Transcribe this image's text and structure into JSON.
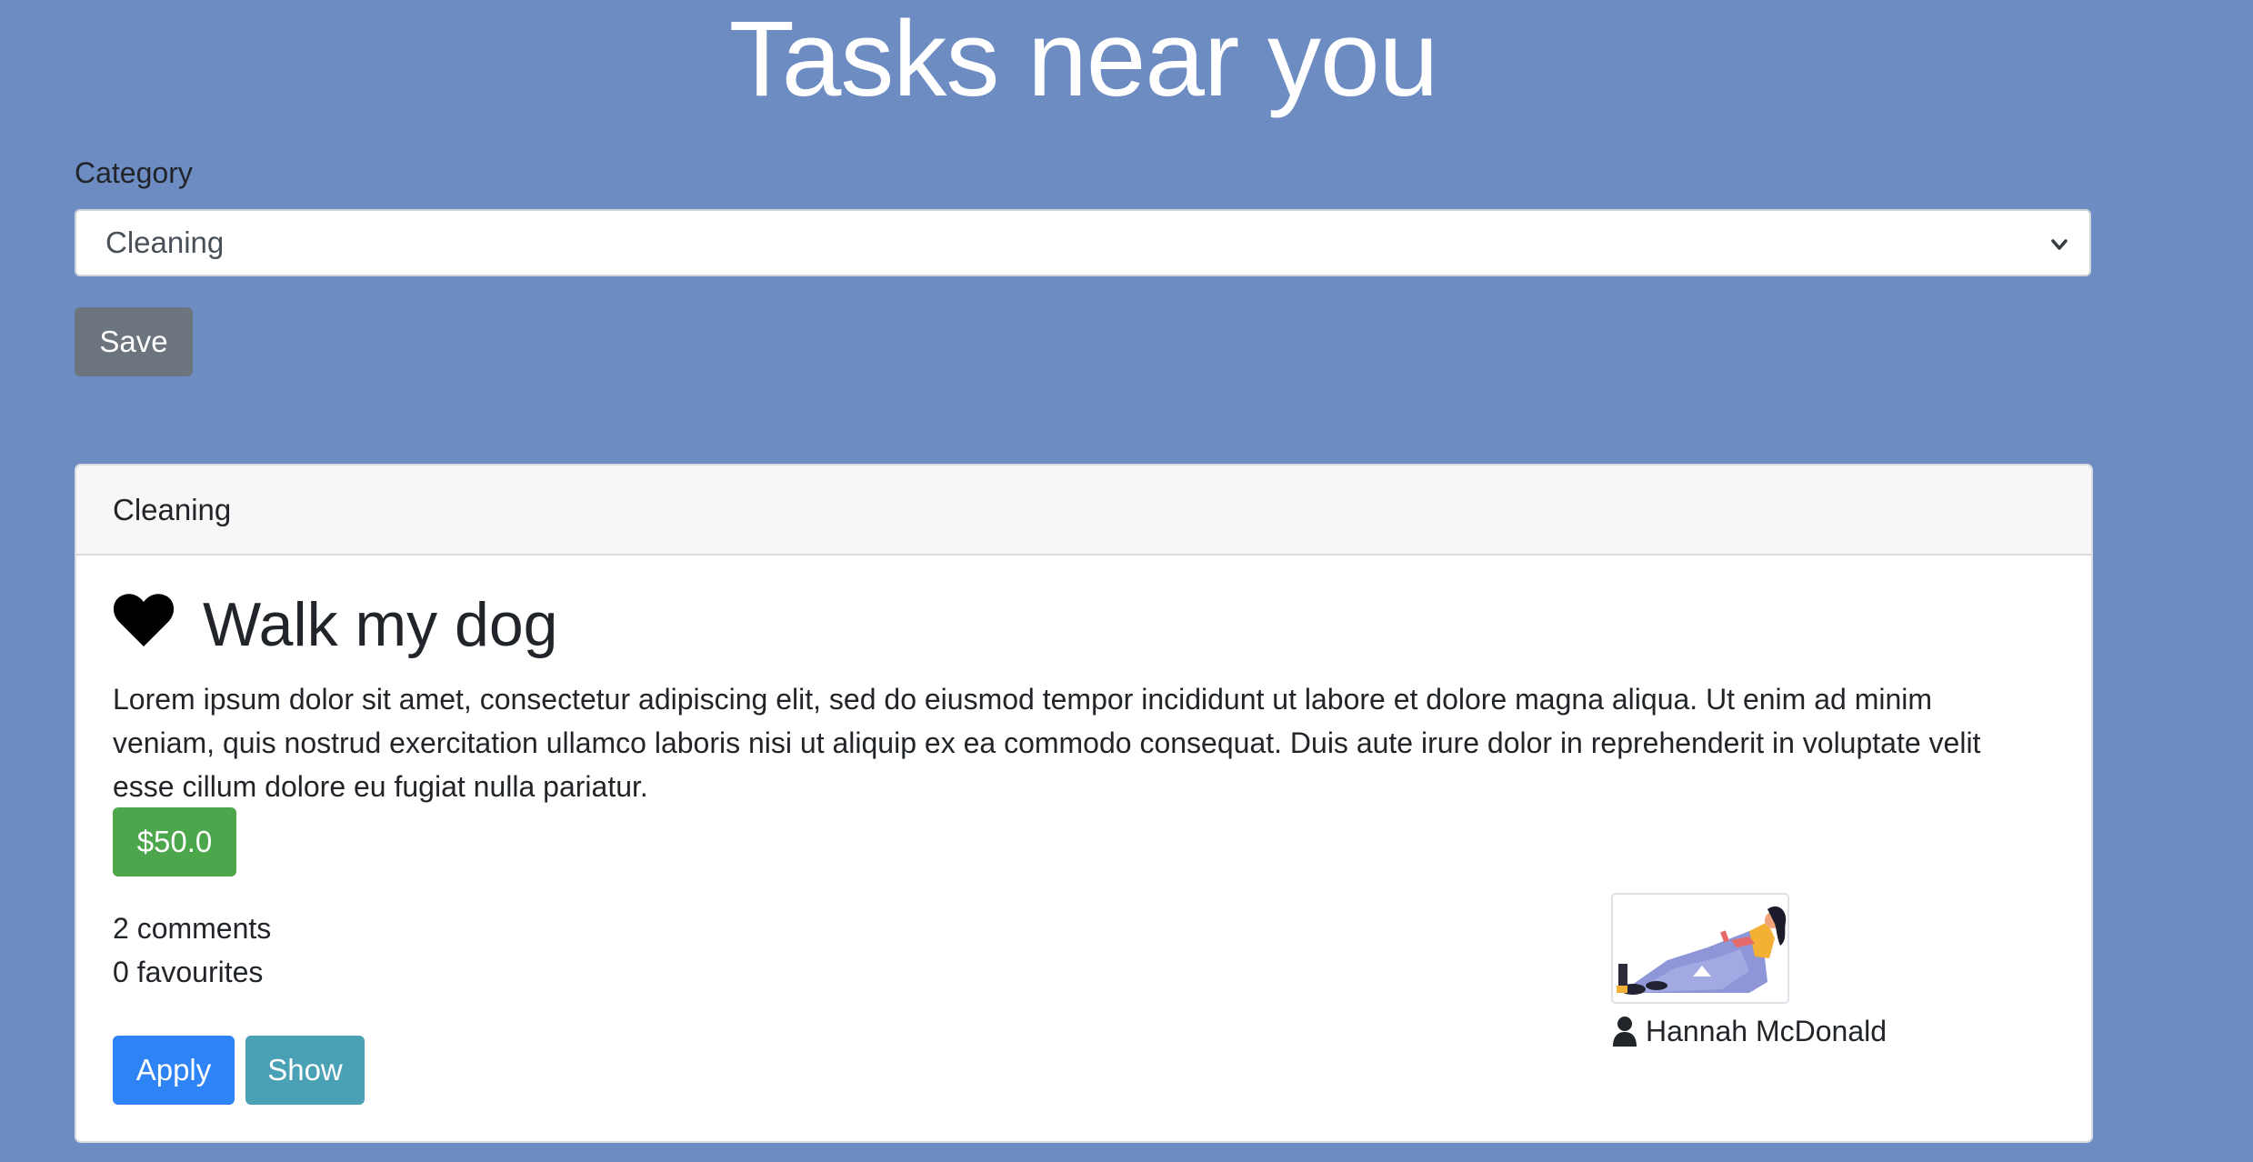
{
  "page": {
    "title": "Tasks near you"
  },
  "filter": {
    "label": "Category",
    "selected": "Cleaning",
    "save_label": "Save"
  },
  "card": {
    "header": "Cleaning",
    "title": "Walk my dog",
    "description": "Lorem ipsum dolor sit amet, consectetur adipiscing elit, sed do eiusmod tempor incididunt ut labore et dolore magna aliqua. Ut enim ad minim veniam, quis nostrud exercitation ullamco laboris nisi ut aliquip ex ea commodo consequat. Duis aute irure dolor in reprehenderit in voluptate velit esse cillum dolore eu fugiat nulla pariatur.",
    "price": "$50.0",
    "comments": "2 comments",
    "favourites": "0 favourites",
    "apply_label": "Apply",
    "show_label": "Show",
    "author": "Hannah McDonald",
    "icons": {
      "favourite": "heart-icon",
      "author": "user-icon"
    }
  },
  "colors": {
    "background": "#6d8cc2",
    "save_button": "#6c757d",
    "price_badge": "#4ca64c",
    "apply_button": "#2f84f5",
    "show_button": "#4aa1b5"
  }
}
